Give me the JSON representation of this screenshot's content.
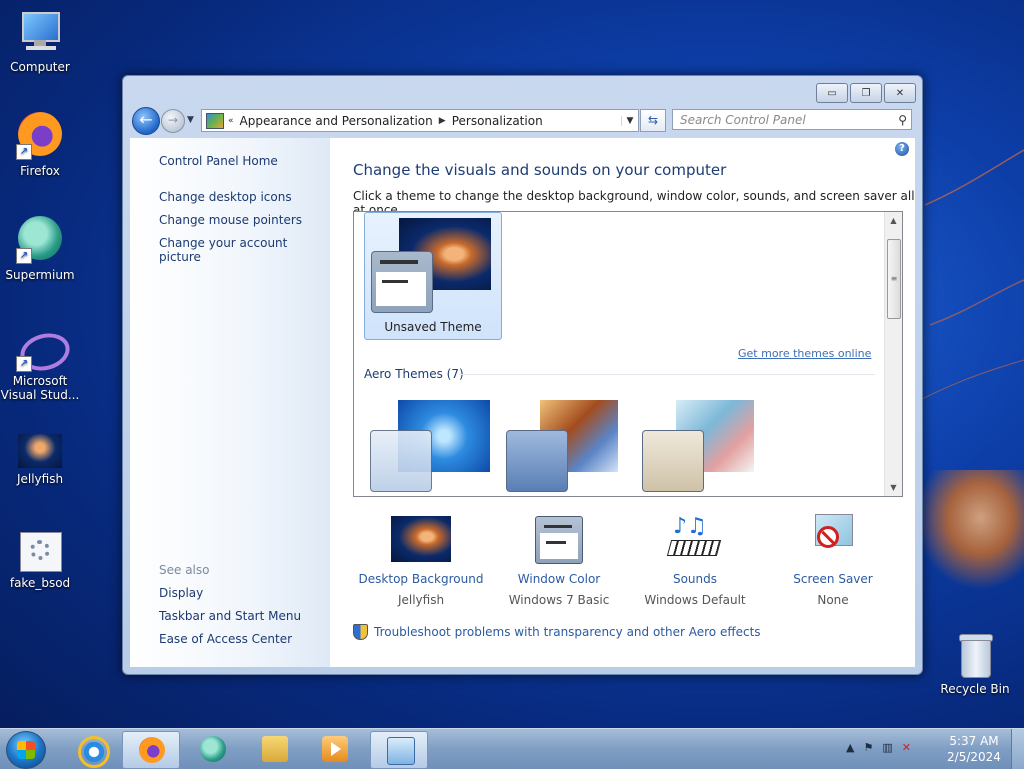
{
  "desktop": {
    "icons": [
      {
        "label": "Computer"
      },
      {
        "label": "Firefox"
      },
      {
        "label": "Supermium"
      },
      {
        "label": "Microsoft Visual Stud..."
      },
      {
        "label": "Jellyfish"
      },
      {
        "label": "fake_bsod"
      },
      {
        "label": "Recycle Bin"
      }
    ]
  },
  "window": {
    "address": {
      "prefix": "«",
      "crumbs": [
        "Appearance and Personalization",
        "Personalization"
      ]
    },
    "search_placeholder": "Search Control Panel",
    "left_pane": {
      "home": "Control Panel Home",
      "links": [
        "Change desktop icons",
        "Change mouse pointers",
        "Change your account picture"
      ],
      "see_also_title": "See also",
      "see_also_links": [
        "Display",
        "Taskbar and Start Menu",
        "Ease of Access Center"
      ]
    },
    "main": {
      "heading": "Change the visuals and sounds on your computer",
      "subtext": "Click a theme to change the desktop background, window color, sounds, and screen saver all at once.",
      "unsaved_theme_label": "Unsaved Theme",
      "more_themes_link": "Get more themes online",
      "aero_group_title": "Aero Themes (7)",
      "settings": [
        {
          "name": "Desktop Background",
          "value": "Jellyfish"
        },
        {
          "name": "Window Color",
          "value": "Windows 7 Basic"
        },
        {
          "name": "Sounds",
          "value": "Windows Default"
        },
        {
          "name": "Screen Saver",
          "value": "None"
        }
      ],
      "troubleshoot_link": "Troubleshoot problems with transparency and other Aero effects"
    }
  },
  "taskbar": {
    "clock_time": "5:37 AM",
    "clock_date": "2/5/2024"
  },
  "colors": {
    "link": "#2c5ba1",
    "heading": "#1d3c73",
    "desktop_bg": "#0d3ea8"
  }
}
